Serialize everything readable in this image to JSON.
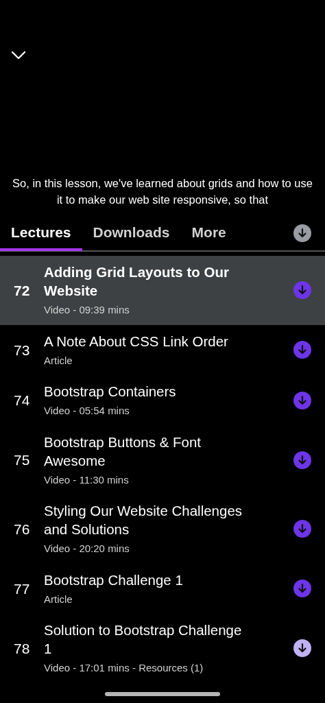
{
  "caption": "So, in this lesson, we've learned about grids and how to use it to make our web site responsive, so that",
  "tabs": [
    {
      "label": "Lectures",
      "selected": true
    },
    {
      "label": "Downloads",
      "selected": false
    },
    {
      "label": "More",
      "selected": false
    }
  ],
  "lectures": [
    {
      "number": "72",
      "title": "Adding Grid Layouts to Our Website",
      "meta": "Video - 09:39 mins",
      "selected": true,
      "dimmed": false
    },
    {
      "number": "73",
      "title": "A Note About CSS Link Order",
      "meta": "Article",
      "selected": false,
      "dimmed": false
    },
    {
      "number": "74",
      "title": "Bootstrap Containers",
      "meta": "Video - 05:54 mins",
      "selected": false,
      "dimmed": false
    },
    {
      "number": "75",
      "title": "Bootstrap Buttons & Font Awesome",
      "meta": "Video - 11:30 mins",
      "selected": false,
      "dimmed": false
    },
    {
      "number": "76",
      "title": "Styling Our Website Challenges and Solutions",
      "meta": "Video - 20:20 mins",
      "selected": false,
      "dimmed": false
    },
    {
      "number": "77",
      "title": "Bootstrap Challenge 1",
      "meta": "Article",
      "selected": false,
      "dimmed": false
    },
    {
      "number": "78",
      "title": "Solution to Bootstrap Challenge 1",
      "meta": "Video - 17:01 mins - Resources (1)",
      "selected": false,
      "dimmed": true
    }
  ]
}
